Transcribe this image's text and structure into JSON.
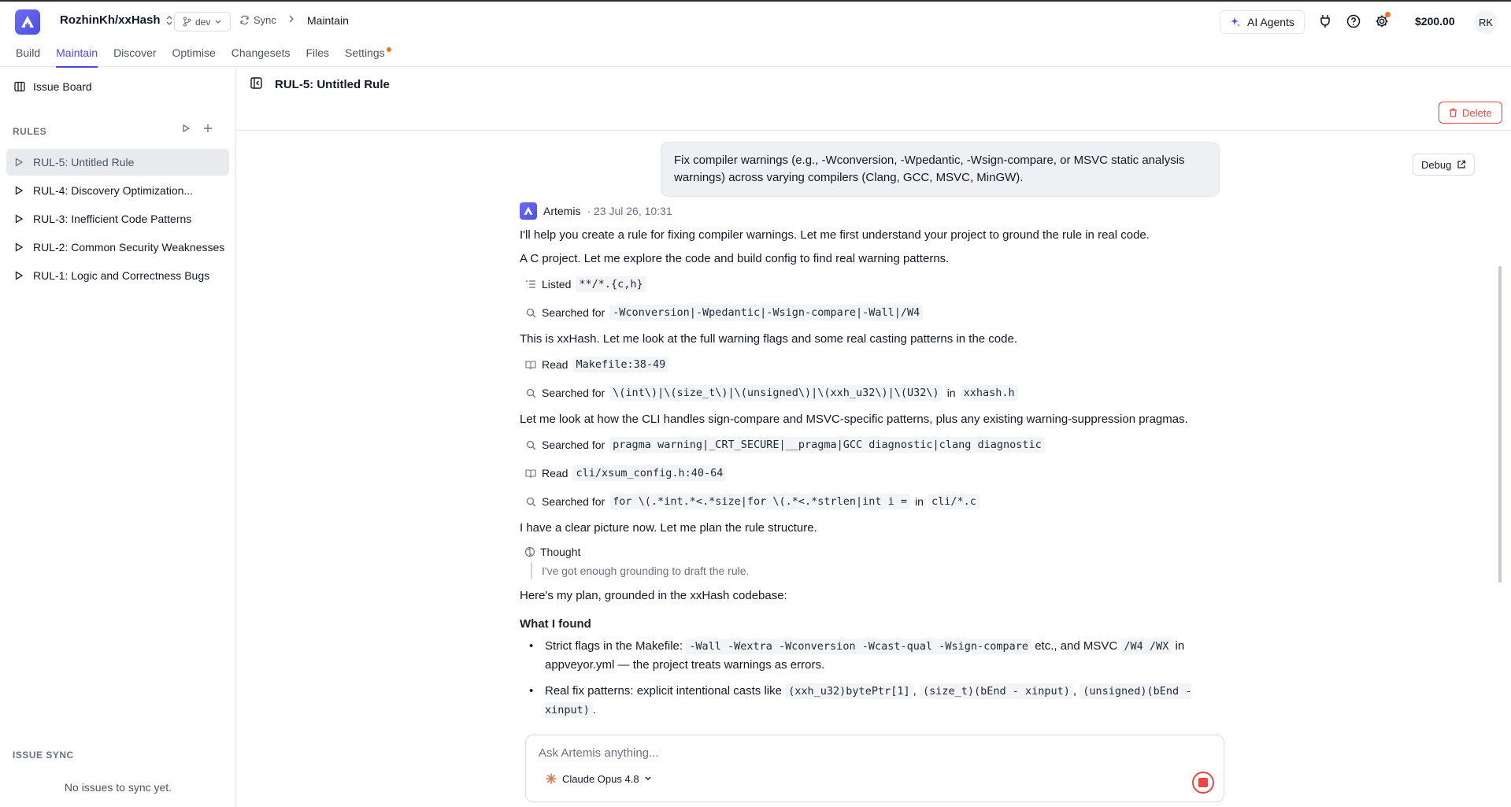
{
  "header": {
    "repo": "RozhinKh/xxHash",
    "branch": "dev",
    "sync_label": "Sync",
    "breadcrumb_current": "Maintain",
    "ai_agents_label": "AI Agents",
    "credits": "$200.00",
    "avatar_initials": "RK"
  },
  "nav": {
    "tabs": [
      {
        "label": "Build"
      },
      {
        "label": "Maintain",
        "active": true
      },
      {
        "label": "Discover"
      },
      {
        "label": "Optimise"
      },
      {
        "label": "Changesets"
      },
      {
        "label": "Files"
      },
      {
        "label": "Settings"
      }
    ]
  },
  "sidebar": {
    "issue_board_label": "Issue Board",
    "rules_heading": "RULES",
    "rules": [
      {
        "label": "RUL-5: Untitled Rule",
        "active": true
      },
      {
        "label": "RUL-4: Discovery Optimization..."
      },
      {
        "label": "RUL-3: Inefficient Code Patterns"
      },
      {
        "label": "RUL-2: Common Security Weaknesses"
      },
      {
        "label": "RUL-1: Logic and Correctness Bugs"
      }
    ],
    "issue_sync_heading": "ISSUE SYNC",
    "issue_sync_empty": "No issues to sync yet."
  },
  "main": {
    "title": "RUL-5: Untitled Rule",
    "delete_label": "Delete",
    "debug_label": "Debug",
    "user_message": "Fix compiler warnings (e.g., -Wconversion, -Wpedantic, -Wsign-compare, or MSVC static analysis warnings) across varying compilers (Clang, GCC, MSVC, MinGW).",
    "agent_name": "Artemis",
    "agent_meta": "· 23 Jul 26, 10:31",
    "p1": "I'll help you create a rule for fixing compiler warnings. Let me first understand your project to ground the rule in real code.",
    "p2": "A C project. Let me explore the code and build config to find real warning patterns.",
    "t1_action": "Listed",
    "t1_code": "**/*.{c,h}",
    "t2_action": "Searched for",
    "t2_code": "-Wconversion|-Wpedantic|-Wsign-compare|-Wall|/W4",
    "p3": "This is xxHash. Let me look at the full warning flags and some real casting patterns in the code.",
    "t3_action": "Read",
    "t3_code": "Makefile:38-49",
    "t4_action": "Searched for",
    "t4_code": "\\(int\\)|\\(size_t\\)|\\(unsigned\\)|\\(xxh_u32\\)|\\(U32\\)",
    "t4_in": "in",
    "t4_file": "xxhash.h",
    "p4": "Let me look at how the CLI handles sign-compare and MSVC-specific patterns, plus any existing warning-suppression pragmas.",
    "t5_action": "Searched for",
    "t5_code": "pragma warning|_CRT_SECURE|__pragma|GCC diagnostic|clang diagnostic",
    "t6_action": "Read",
    "t6_code": "cli/xsum_config.h:40-64",
    "t7_action": "Searched for",
    "t7_code": "for \\(.*int.*<.*size|for \\(.*<.*strlen|int i =",
    "t7_in": "in",
    "t7_file": "cli/*.c",
    "p5": "I have a clear picture now. Let me plan the rule structure.",
    "thought_label": "Thought",
    "thought_text": "I've got enough grounding to draft the rule.",
    "p6": "Here's my plan, grounded in the xxHash codebase:",
    "h_found": "What I found",
    "b1_pre": "Strict flags in the Makefile: ",
    "b1_code1": "-Wall -Wextra -Wconversion -Wcast-qual -Wsign-compare",
    "b1_mid": " etc., and MSVC ",
    "b1_code2": "/W4 /WX",
    "b1_post": " in appveyor.yml — the project treats warnings as errors.",
    "b2_pre": "Real fix patterns: explicit intentional casts like ",
    "b2_code1": "(xxh_u32)bytePtr[1]",
    "b2_sep1": ", ",
    "b2_code2": "(size_t)(bEnd - xinput)",
    "b2_sep2": ", ",
    "b2_code3": "(unsigned)(bEnd -xinput)",
    "b2_post": "."
  },
  "composer": {
    "placeholder": "Ask Artemis anything...",
    "model": "Claude Opus 4.8"
  },
  "colors": {
    "accent": "#4f46e5",
    "danger": "#ef4444",
    "notify": "#f97316"
  }
}
